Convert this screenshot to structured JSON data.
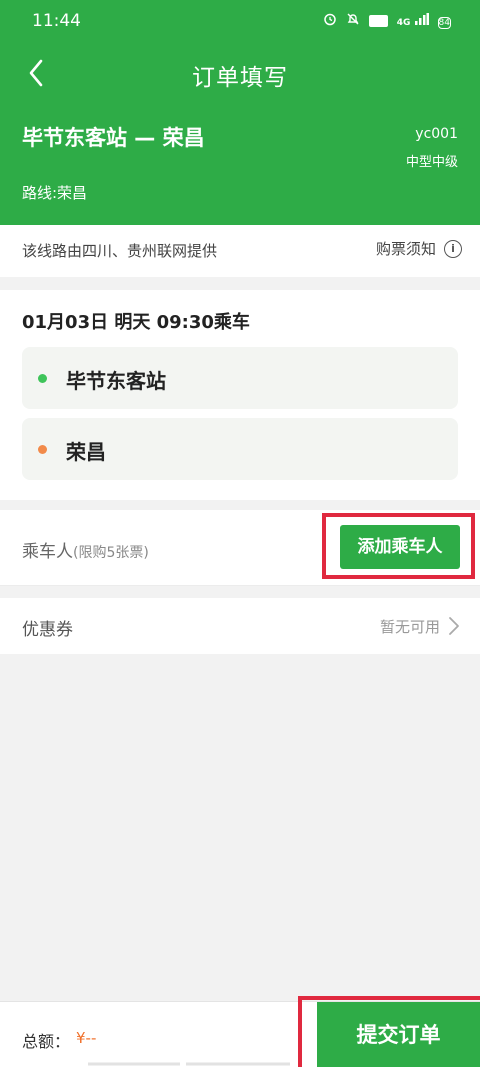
{
  "status_bar": {
    "time": "11:44",
    "network": "4G",
    "hd": "HD",
    "battery": "84",
    "icons": [
      "alarm-icon",
      "mute-icon",
      "hd-icon",
      "signal-icon",
      "battery-icon"
    ]
  },
  "nav": {
    "title": "订单填写",
    "back_icon": "chevron-left-icon"
  },
  "route": {
    "title": "毕节东客站 — 荣昌",
    "bus_code": "yc001",
    "bus_type": "中型中级",
    "line": "路线:荣昌"
  },
  "notice": {
    "text": "该线路由四川、贵州联网提供",
    "link_label": "购票须知",
    "icon": "info-icon",
    "icon_glyph": "i"
  },
  "trip": {
    "depart": "01月03日 明天 09:30乘车",
    "start_station": "毕节东客站",
    "end_station": "荣昌"
  },
  "passenger": {
    "label": "乘车人",
    "limit": "(限购5张票)",
    "add_button": "添加乘车人"
  },
  "coupon": {
    "label": "优惠券",
    "value": "暂无可用"
  },
  "footer": {
    "total_label": "总额：",
    "total_value": "¥--",
    "submit_label": "提交订单"
  },
  "colors": {
    "brand_green": "#2eac47",
    "highlight_red": "#e0293f",
    "price_orange": "#f0702a",
    "start_dot": "#3ec45a",
    "end_dot": "#f28a4a"
  }
}
